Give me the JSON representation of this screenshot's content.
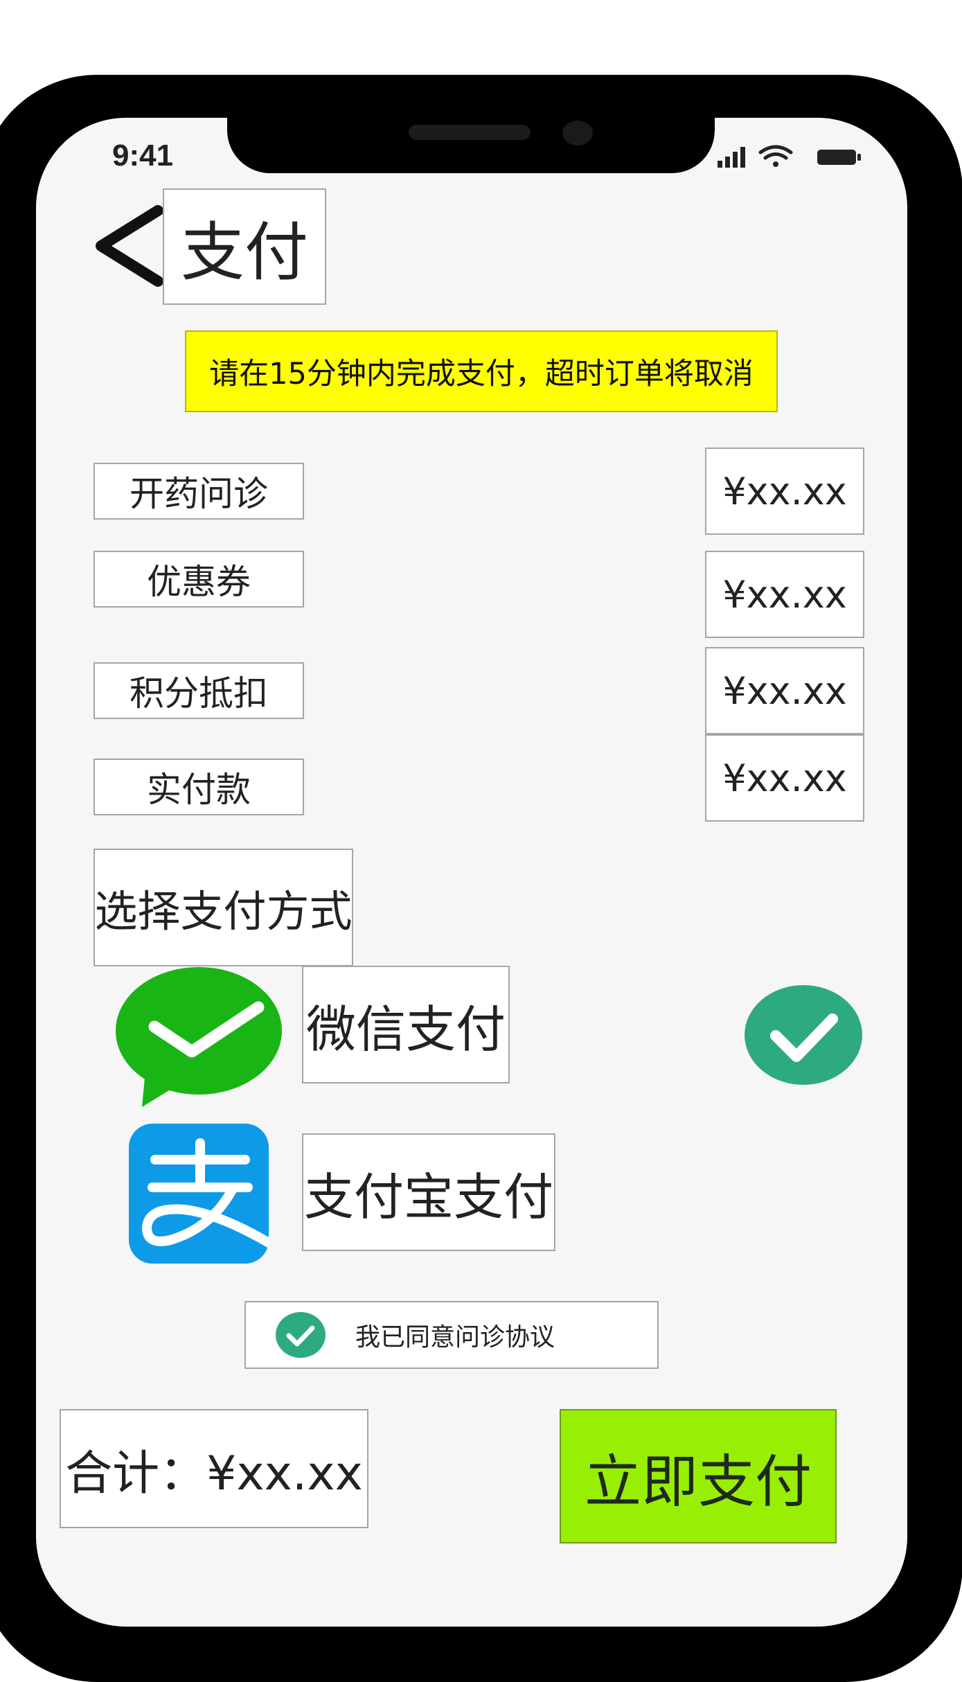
{
  "status_bar": {
    "time": "9:41"
  },
  "header": {
    "title": "支付",
    "back_icon": "chevron-left-icon"
  },
  "notice": {
    "text": "请在15分钟内完成支付，超时订单将取消",
    "background": "#ffff00"
  },
  "fees": [
    {
      "label": "开药问诊",
      "amount": "¥xx.xx"
    },
    {
      "label": "优惠券",
      "amount": "¥xx.xx"
    },
    {
      "label": "积分抵扣",
      "amount": "¥xx.xx"
    },
    {
      "label": "实付款",
      "amount": "¥xx.xx"
    }
  ],
  "payment": {
    "section_title": "选择支付方式",
    "methods": [
      {
        "label": "微信支付",
        "icon": "wechat-icon",
        "selected": true
      },
      {
        "label": "支付宝支付",
        "icon": "alipay-icon",
        "selected": false
      }
    ],
    "selected_color": "#2eaa80"
  },
  "agreement": {
    "text": "我已同意问诊协议",
    "checked": true
  },
  "footer": {
    "total": "合计：¥xx.xx",
    "pay_button": "立即支付",
    "pay_button_color": "#99ef04"
  }
}
